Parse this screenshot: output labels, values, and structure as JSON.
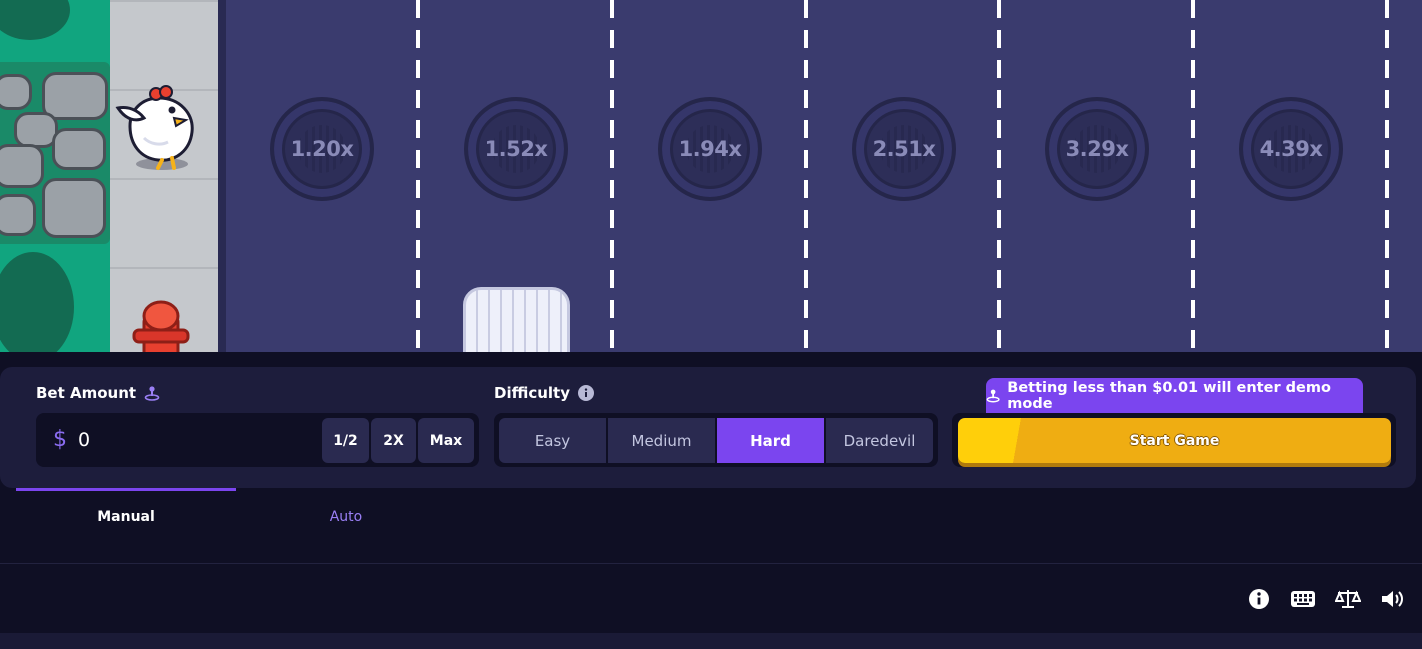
{
  "game": {
    "multipliers": [
      "1.20x",
      "1.52x",
      "1.94x",
      "2.51x",
      "3.29x",
      "4.39x"
    ]
  },
  "bet": {
    "label": "Bet Amount",
    "currency_symbol": "$",
    "value": "0",
    "quick_buttons": [
      "1/2",
      "2X",
      "Max"
    ]
  },
  "difficulty": {
    "label": "Difficulty",
    "options": [
      "Easy",
      "Medium",
      "Hard",
      "Daredevil"
    ],
    "selected": "Hard"
  },
  "demo_notice": "Betting less than $0.01 will enter demo mode",
  "start_button": "Start Game",
  "tabs": [
    {
      "label": "Manual",
      "active": true
    },
    {
      "label": "Auto",
      "active": false
    }
  ],
  "footer_icons": [
    "info-icon",
    "keyboard-icon",
    "fairness-scale-icon",
    "volume-icon"
  ],
  "colors": {
    "accent": "#7b45ef",
    "start_button": "#efad12",
    "road": "#3a3b6e",
    "panel": "#1d1d3c",
    "background": "#0f0f24"
  }
}
